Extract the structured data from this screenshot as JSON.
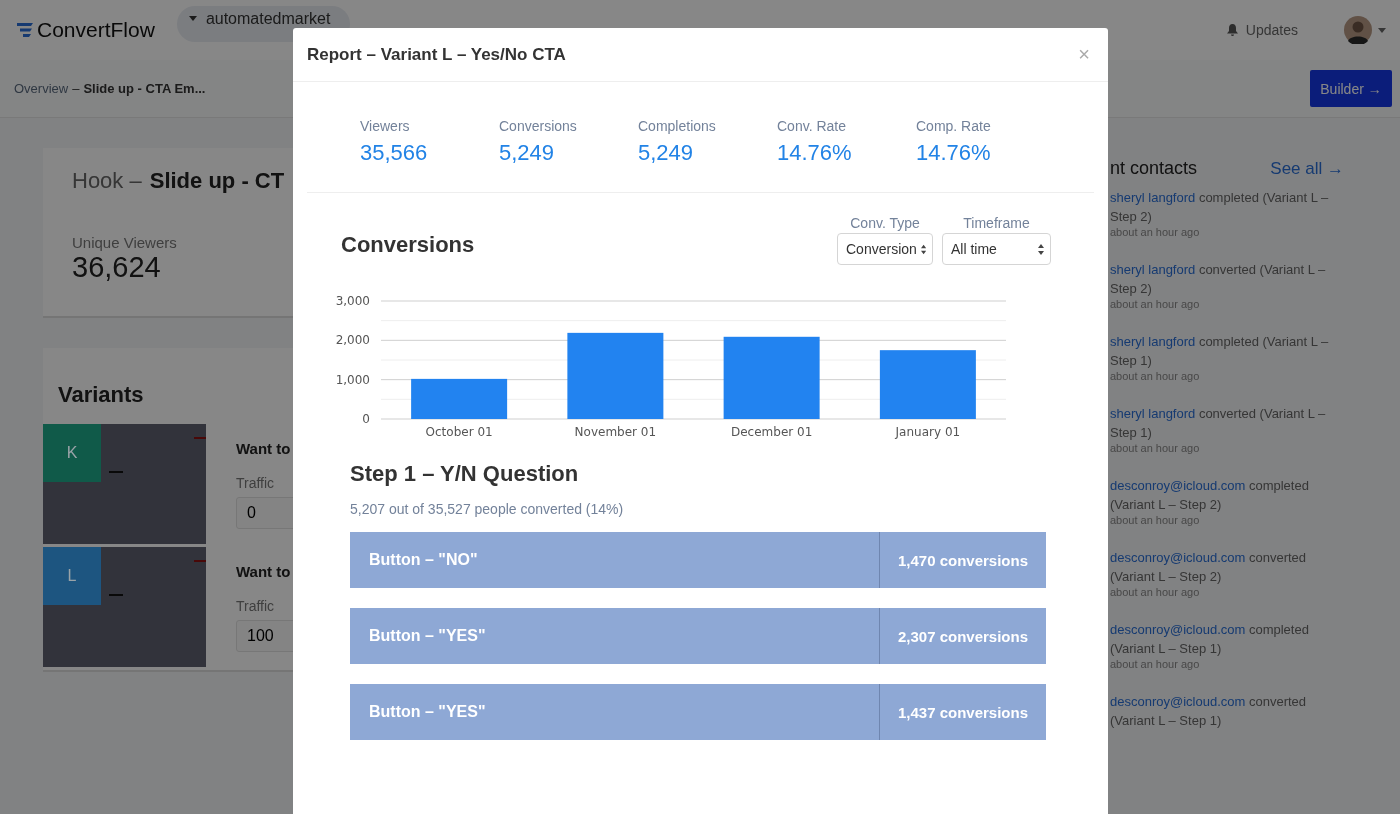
{
  "topbar": {
    "logo": "ConvertFlow",
    "account": "automatedmarket",
    "updates": "Updates"
  },
  "subbar": {
    "breadcrumb_link": "Overview",
    "breadcrumb_sep": "–",
    "breadcrumb_current": "Slide up - CTA Em...",
    "builder_button": "Builder →"
  },
  "hook_card": {
    "prefix": "Hook –",
    "title": "Slide up - CT",
    "stat_label": "Unique Viewers",
    "stat_value": "36,624"
  },
  "variants_card": {
    "title": "Variants",
    "variants": [
      {
        "letter": "K",
        "color": "#105a49",
        "heading": "Want to",
        "traffic_label": "Traffic",
        "traffic": "0"
      },
      {
        "letter": "L",
        "color": "#1d5580",
        "heading": "Want to",
        "traffic_label": "Traffic",
        "traffic": "100"
      }
    ]
  },
  "recent_contacts": {
    "title": "nt contacts",
    "see_all": "See all →",
    "items": [
      {
        "name": "sheryl langford",
        "action": "completed (Variant L – Step 2)",
        "time": "about an hour ago"
      },
      {
        "name": "sheryl langford",
        "action": "converted (Variant L – Step 2)",
        "time": "about an hour ago"
      },
      {
        "name": "sheryl langford",
        "action": "completed (Variant L – Step 1)",
        "time": "about an hour ago"
      },
      {
        "name": "sheryl langford",
        "action": "converted (Variant L – Step 1)",
        "time": "about an hour ago"
      },
      {
        "name": "desconroy@icloud.com",
        "action": "completed (Variant L – Step 2)",
        "time": "about an hour ago"
      },
      {
        "name": "desconroy@icloud.com",
        "action": "converted (Variant L – Step 2)",
        "time": "about an hour ago"
      },
      {
        "name": "desconroy@icloud.com",
        "action": "completed (Variant L – Step 1)",
        "time": "about an hour ago"
      },
      {
        "name": "desconroy@icloud.com",
        "action": "converted (Variant L – Step 1)"
      }
    ]
  },
  "modal": {
    "title": "Report – Variant L – Yes/No CTA",
    "close": "×",
    "stats": [
      {
        "label": "Viewers",
        "value": "35,566"
      },
      {
        "label": "Conversions",
        "value": "5,249"
      },
      {
        "label": "Completions",
        "value": "5,249"
      },
      {
        "label": "Conv. Rate",
        "value": "14.76%"
      },
      {
        "label": "Comp. Rate",
        "value": "14.76%"
      }
    ],
    "chart_title": "Conversions",
    "filters": [
      {
        "label": "Conv. Type",
        "value": "Conversion"
      },
      {
        "label": "Timeframe",
        "value": "All time"
      }
    ],
    "chart_data": {
      "type": "bar",
      "categories": [
        "October 01",
        "November 01",
        "December 01",
        "January 01"
      ],
      "series": [
        {
          "color": "#2283f0",
          "values": [
            1020,
            2190,
            2090,
            1750
          ]
        }
      ],
      "ylim": [
        0,
        3000
      ],
      "yticks": [
        {
          "value": 0,
          "label": "0"
        },
        {
          "value": 1000,
          "label": "1,000"
        },
        {
          "value": 2000,
          "label": "2,000"
        },
        {
          "value": 3000,
          "label": "3,000"
        }
      ]
    },
    "step_title": "Step 1 – Y/N Question",
    "step_summary": "5,207 out of 35,527 people converted (14%)",
    "buttons": [
      {
        "label": "Button – \"NO\"",
        "count": "1,470 conversions"
      },
      {
        "label": "Button – \"YES\"",
        "count": "2,307 conversions"
      },
      {
        "label": "Button – \"YES\"",
        "count": "1,437 conversions"
      }
    ]
  }
}
